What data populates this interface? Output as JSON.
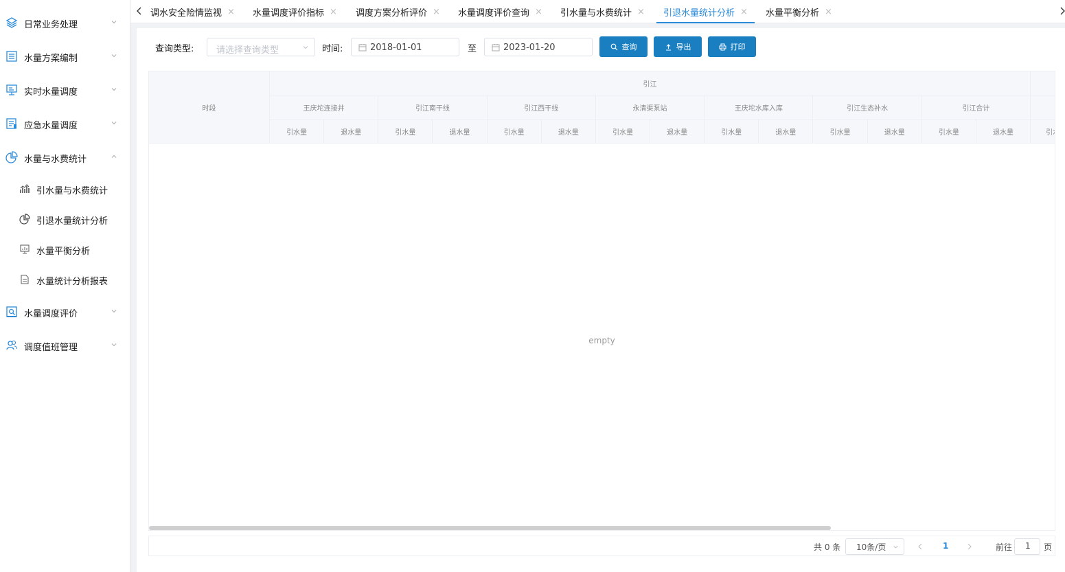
{
  "sidebar": {
    "items": [
      {
        "label": "日常业务处理",
        "icon": "layers-icon",
        "expanded": false
      },
      {
        "label": "水量方案编制",
        "icon": "list-icon",
        "expanded": false
      },
      {
        "label": "实时水量调度",
        "icon": "monitor-icon",
        "expanded": false
      },
      {
        "label": "应急水量调度",
        "icon": "document-icon",
        "expanded": false
      },
      {
        "label": "水量与水费统计",
        "icon": "pie-chart-icon",
        "expanded": true
      },
      {
        "label": "水量调度评价",
        "icon": "evaluation-icon",
        "expanded": false
      },
      {
        "label": "调度值班管理",
        "icon": "people-icon",
        "expanded": false
      }
    ],
    "sub_items": [
      {
        "label": "引水量与水费统计",
        "icon": "bar-chart-icon"
      },
      {
        "label": "引退水量统计分析",
        "icon": "pie-chart-icon"
      },
      {
        "label": "水量平衡分析",
        "icon": "monitor-icon"
      },
      {
        "label": "水量统计分析报表",
        "icon": "report-icon"
      }
    ]
  },
  "tabs": [
    {
      "label": "调水安全险情监视",
      "active": false
    },
    {
      "label": "水量调度评价指标",
      "active": false
    },
    {
      "label": "调度方案分析评价",
      "active": false
    },
    {
      "label": "水量调度评价查询",
      "active": false
    },
    {
      "label": "引水量与水费统计",
      "active": false
    },
    {
      "label": "引退水量统计分析",
      "active": true
    },
    {
      "label": "水量平衡分析",
      "active": false
    }
  ],
  "tab_close_glyph": "×",
  "filters": {
    "query_type_label": "查询类型:",
    "query_type_placeholder": "请选择查询类型",
    "time_label": "时间:",
    "start_date": "2018-01-01",
    "to_label": "至",
    "end_date": "2023-01-20"
  },
  "buttons": {
    "query": "查询",
    "export": "导出",
    "print": "打印"
  },
  "table": {
    "period_header": "时段",
    "group_header": "引江",
    "stations": [
      "王庆坨连接井",
      "引江南干线",
      "引江西干线",
      "永清渠泵站",
      "王庆坨水库入库",
      "引江生态补水",
      "引江合计"
    ],
    "in_label": "引水量",
    "out_label": "退水量",
    "truncated_label": "引水量",
    "empty_text": "empty"
  },
  "pagination": {
    "total": "共 0 条",
    "page_size": "10条/页",
    "current_page": "1",
    "goto_label": "前往",
    "goto_value": "1",
    "page_suffix": "页"
  },
  "colors": {
    "accent": "#2b8bd8",
    "button": "#1a7fc1"
  }
}
